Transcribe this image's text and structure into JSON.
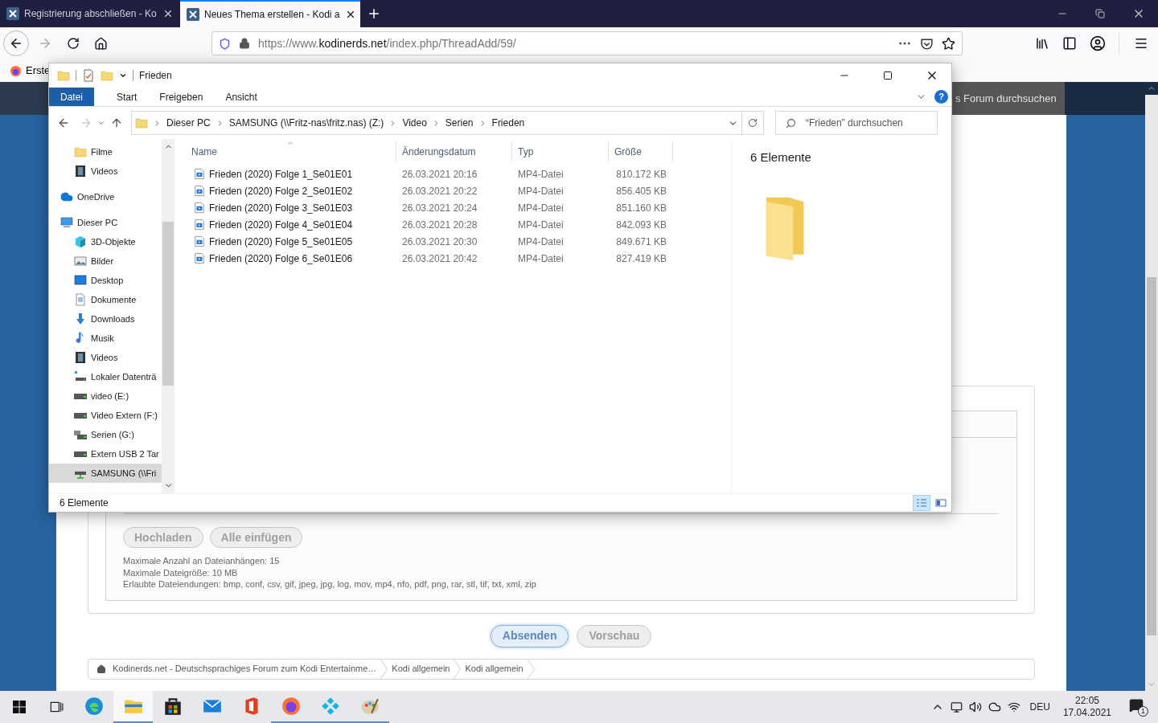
{
  "browser": {
    "tabs": [
      {
        "title": "Registrierung abschließen - Ko",
        "selected": false
      },
      {
        "title": "Neues Thema erstellen - Kodi a",
        "selected": true
      }
    ],
    "url": {
      "scheme": "https://www.",
      "domain": "kodinerds.net",
      "path": "/index.php/ThreadAdd/59/"
    },
    "bookmark": "Erste"
  },
  "page": {
    "search_placeholder": "s Forum durchsuchen",
    "upload_buttons": [
      "Hochladen",
      "Alle einfügen"
    ],
    "upload_info": [
      "Maximale Anzahl an Dateianhängen: 15",
      "Maximale Dateigröße: 10 MB",
      "Erlaubte Dateiendungen: bmp, conf, csv, gif, jpeg, jpg, log, mov, mp4, nfo, pdf, png, rar, stl, tif, txt, xml, zip"
    ],
    "actions": [
      {
        "label": "Absenden",
        "kind": "primary"
      },
      {
        "label": "Vorschau",
        "kind": "secondary"
      }
    ],
    "breadcrumbs": [
      "Kodinerds.net - Deutschsprachiges Forum zum Kodi Entertainme…",
      "Kodi allgemein",
      "Kodi allgemein"
    ]
  },
  "explorer": {
    "title": "Frieden",
    "ribbon_tabs": [
      {
        "label": "Datei",
        "kind": "file-menu"
      },
      {
        "label": "Start",
        "kind": "tab"
      },
      {
        "label": "Freigeben",
        "kind": "tab"
      },
      {
        "label": "Ansicht",
        "kind": "tab"
      }
    ],
    "path": [
      "Dieser PC",
      "SAMSUNG (\\\\Fritz-nas\\fritz.nas) (Z:)",
      "Video",
      "Serien",
      "Frieden"
    ],
    "search_placeholder": "“Frieden” durchsuchen",
    "help": "?",
    "sidebar": {
      "quick_access_children": [
        {
          "label": "Filme",
          "kind": "folder",
          "selected": false
        },
        {
          "label": "Videos",
          "kind": "video",
          "selected": false
        }
      ],
      "items": [
        {
          "label": "OneDrive",
          "kind": "cloud",
          "selected": false
        },
        {
          "label": "Dieser PC",
          "kind": "pc",
          "selected": false,
          "children": [
            {
              "label": "3D-Objekte",
              "kind": "cube",
              "selected": false
            },
            {
              "label": "Bilder",
              "kind": "pictures",
              "selected": false
            },
            {
              "label": "Desktop",
              "kind": "desktop",
              "selected": false
            },
            {
              "label": "Dokumente",
              "kind": "documents",
              "selected": false
            },
            {
              "label": "Downloads",
              "kind": "download",
              "selected": false
            },
            {
              "label": "Musik",
              "kind": "music",
              "selected": false
            },
            {
              "label": "Videos",
              "kind": "video",
              "selected": false
            },
            {
              "label": "Lokaler Datenträ",
              "kind": "system-drive",
              "selected": false
            },
            {
              "label": "video (E:)",
              "kind": "drive",
              "selected": false
            },
            {
              "label": "Video Extern (F:)",
              "kind": "drive",
              "selected": false
            },
            {
              "label": "Serien (G:)",
              "kind": "network-drive",
              "selected": false
            },
            {
              "label": "Extern USB 2 Tar",
              "kind": "drive",
              "selected": false
            },
            {
              "label": "SAMSUNG (\\\\Fri",
              "kind": "mapped-drive",
              "selected": true
            }
          ]
        }
      ]
    },
    "columns": [
      "Name",
      "Änderungsdatum",
      "Typ",
      "Größe"
    ],
    "files": [
      {
        "name": "Frieden (2020) Folge 1_Se01E01",
        "date": "26.03.2021 20:16",
        "type": "MP4-Datei",
        "size": "810.172 KB"
      },
      {
        "name": "Frieden (2020) Folge 2_Se01E02",
        "date": "26.03.2021 20:22",
        "type": "MP4-Datei",
        "size": "856.405 KB"
      },
      {
        "name": "Frieden (2020) Folge 3_Se01E03",
        "date": "26.03.2021 20:24",
        "type": "MP4-Datei",
        "size": "851.160 KB"
      },
      {
        "name": "Frieden (2020) Folge 4_Se01E04",
        "date": "26.03.2021 20:28",
        "type": "MP4-Datei",
        "size": "842.093 KB"
      },
      {
        "name": "Frieden (2020) Folge 5_Se01E05",
        "date": "26.03.2021 20:30",
        "type": "MP4-Datei",
        "size": "849.671 KB"
      },
      {
        "name": "Frieden (2020) Folge 6_Se01E06",
        "date": "26.03.2021 20:42",
        "type": "MP4-Datei",
        "size": "827.419 KB"
      }
    ],
    "preview_text": "6 Elemente",
    "status": "6 Elemente",
    "views": [
      {
        "kind": "details",
        "selected": true
      },
      {
        "kind": "tiles",
        "selected": false
      }
    ]
  },
  "taskbar": {
    "apps": [
      {
        "kind": "edge",
        "active": false,
        "running": false
      },
      {
        "kind": "explorer",
        "active": true,
        "running": true
      },
      {
        "kind": "store",
        "active": false,
        "running": false
      },
      {
        "kind": "mail",
        "active": false,
        "running": false
      },
      {
        "kind": "office",
        "active": false,
        "running": false
      },
      {
        "kind": "firefox",
        "active": false,
        "running": true
      },
      {
        "kind": "kodi",
        "active": false,
        "running": true
      },
      {
        "kind": "paint",
        "active": false,
        "running": true
      }
    ],
    "language": "DEU",
    "time": "22:05",
    "date": "17.04.2021",
    "notifications": "1"
  }
}
